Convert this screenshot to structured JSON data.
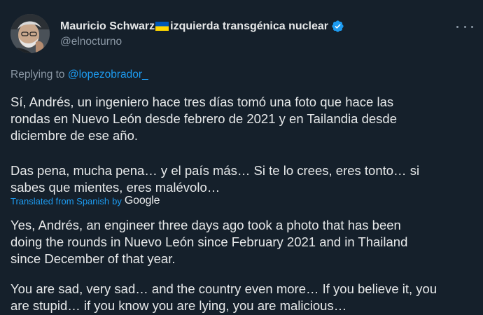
{
  "author": {
    "display_name_prefix": "Mauricio Schwarz",
    "display_name_suffix": "izquierda transgénica nuclear",
    "handle": "@elnocturno",
    "flag_icon": "ukraine-flag-icon",
    "verified_icon": "verified-badge-icon"
  },
  "reply": {
    "label": "Replying to",
    "mention": "@lopezobrador_"
  },
  "original": {
    "paragraph1": "Sí, Andrés, un ingeniero hace tres días tomó una foto que hace las\nrondas en Nuevo León desde febrero de 2021 y en Tailandia desde\ndiciembre de ese año.",
    "paragraph2": "Das pena, mucha pena… y el país más… Si te lo crees, eres tonto… si\nsabes que mientes, eres malévolo…"
  },
  "translation": {
    "label": "Translated from Spanish",
    "by": "by",
    "provider": "Google"
  },
  "translated": {
    "paragraph1": "Yes, Andrés, an engineer three days ago took a photo that has been\ndoing the rounds in Nuevo León since February 2021 and in Thailand\nsince December of that year.",
    "paragraph2": "You are sad, very sad… and the country even more… If you believe it, you\nare stupid… if you know you are lying, you are malicious…"
  },
  "colors": {
    "background": "#15202b",
    "text": "#e7e9ea",
    "muted": "#8b98a5",
    "accent": "#1d9bf0"
  },
  "icons": {
    "more": "more-options-icon"
  }
}
